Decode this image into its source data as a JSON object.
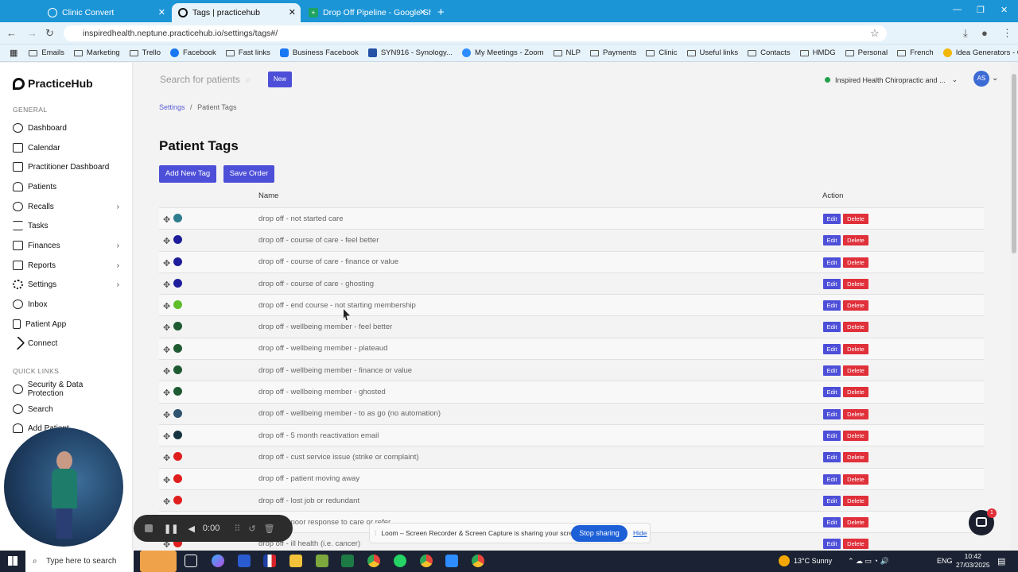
{
  "browser": {
    "tabs": [
      {
        "label": "Clinic Convert",
        "active": false
      },
      {
        "label": "Tags | practicehub",
        "active": true
      },
      {
        "label": "Drop Off Pipeline - Google She",
        "active": false
      }
    ],
    "new_tab": "+",
    "url": "inspiredhealth.neptune.practicehub.io/settings/tags#/",
    "bookmarks": [
      "Emails",
      "Marketing",
      "Trello",
      "Facebook",
      "Fast links",
      "Business Facebook",
      "SYN916 - Synology...",
      "My Meetings - Zoom",
      "NLP",
      "Payments",
      "Clinic",
      "Useful links",
      "Contacts",
      "HMDG",
      "Personal",
      "French",
      "Idea Generators - C..."
    ]
  },
  "app": {
    "logo": "PracticeHub",
    "sections": {
      "general": "GENERAL",
      "quick_links": "QUICK LINKS"
    },
    "nav": [
      {
        "label": "Dashboard",
        "has_children": false
      },
      {
        "label": "Calendar",
        "has_children": false
      },
      {
        "label": "Practitioner Dashboard",
        "has_children": false
      },
      {
        "label": "Patients",
        "has_children": false
      },
      {
        "label": "Recalls",
        "has_children": true
      },
      {
        "label": "Tasks",
        "has_children": false
      },
      {
        "label": "Finances",
        "has_children": true
      },
      {
        "label": "Reports",
        "has_children": true
      },
      {
        "label": "Settings",
        "has_children": true
      },
      {
        "label": "Inbox",
        "has_children": false
      },
      {
        "label": "Patient App",
        "has_children": false
      },
      {
        "label": "Connect",
        "has_children": false
      }
    ],
    "quick_links": [
      "Security & Data Protection",
      "Search",
      "Add Patient"
    ],
    "search_placeholder": "Search for patients",
    "new_button": "New",
    "clinic_name": "Inspired Health Chiropractic and ...",
    "avatar_initials": "AS"
  },
  "page": {
    "breadcrumb": {
      "root": "Settings",
      "separator": "/",
      "current": "Patient Tags"
    },
    "title": "Patient Tags",
    "add_button": "Add New Tag",
    "save_button": "Save Order",
    "columns": {
      "name": "Name",
      "action": "Action"
    },
    "edit_label": "Edit",
    "delete_label": "Delete",
    "tags": [
      {
        "name": "drop off - not started care",
        "color": "#2e7d8f"
      },
      {
        "name": "drop off - course of care - feel better",
        "color": "#1e1e9c"
      },
      {
        "name": "drop off - course of care - finance or value",
        "color": "#1e1e9c"
      },
      {
        "name": "drop off - course of care - ghosting",
        "color": "#1e1e9c"
      },
      {
        "name": "drop off - end course - not starting membership",
        "color": "#5fbf2a"
      },
      {
        "name": "drop off - wellbeing member - feel better",
        "color": "#1f5a32"
      },
      {
        "name": "drop off - wellbeing member - plateaud",
        "color": "#1f5a32"
      },
      {
        "name": "drop off - wellbeing member - finance or value",
        "color": "#1f5a32"
      },
      {
        "name": "drop off - wellbeing member - ghosted",
        "color": "#1f5a32"
      },
      {
        "name": "drop off - wellbeing member - to as go (no automation)",
        "color": "#2d5370"
      },
      {
        "name": "drop off - 5 month reactivation email",
        "color": "#163540"
      },
      {
        "name": "drop off - cust service issue (strike or complaint)",
        "color": "#e01e1e"
      },
      {
        "name": "drop off - patient moving away",
        "color": "#e01e1e"
      },
      {
        "name": "drop off - lost job or redundant",
        "color": "#e01e1e"
      },
      {
        "name": "drop off - poor response to care or refer",
        "color": "#e01e1e"
      },
      {
        "name": "drop off - ill health (i.e. cancer)",
        "color": "#e01e1e"
      }
    ]
  },
  "overlay": {
    "recorder_time": "0:00",
    "loom_message": "Loom – Screen Recorder & Screen Capture is sharing your screen.",
    "stop_sharing": "Stop sharing",
    "hide": "Hide",
    "chat_badge": "1"
  },
  "taskbar": {
    "search_placeholder": "Type here to search",
    "weather": "13°C  Sunny",
    "language": "ENG",
    "time": "10:42",
    "date": "27/03/2025"
  }
}
